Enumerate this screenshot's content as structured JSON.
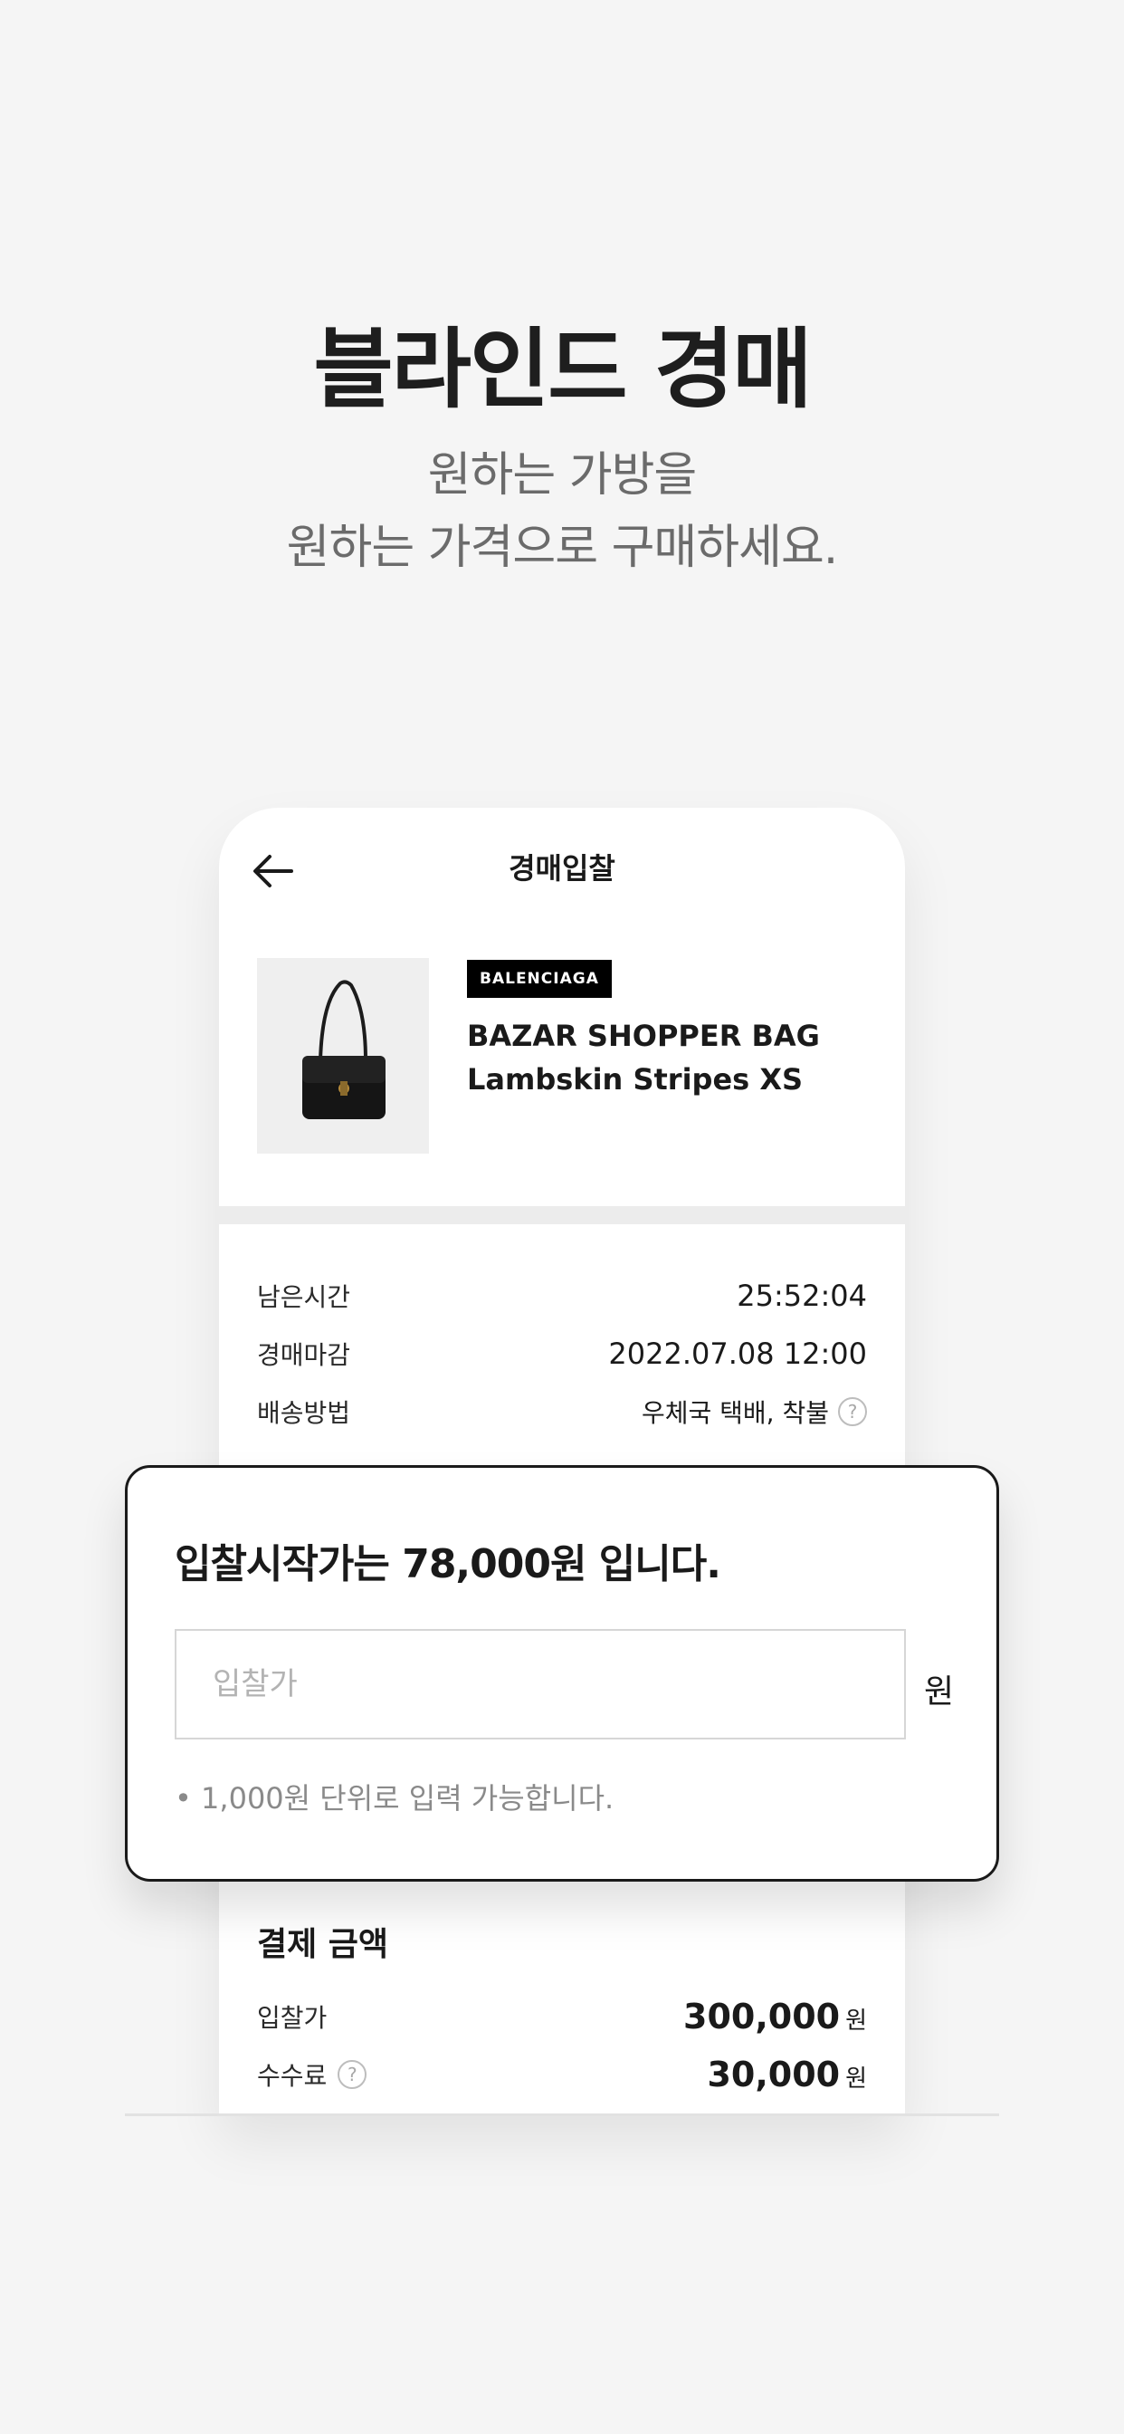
{
  "hero": {
    "title": "블라인드 경매",
    "subtitle_line1": "원하는 가방을",
    "subtitle_line2": "원하는 가격으로 구매하세요."
  },
  "app_bar": {
    "title": "경매입찰",
    "back_icon": "arrow-left-icon"
  },
  "product": {
    "brand": "BALENCIAGA",
    "name_line1": "BAZAR SHOPPER BAG",
    "name_line2": "Lambskin Stripes XS",
    "image_icon": "handbag-icon"
  },
  "auction_info": [
    {
      "label": "남은시간",
      "value": "25:52:04"
    },
    {
      "label": "경매마감",
      "value": "2022.07.08 12:00"
    },
    {
      "label": "배송방법",
      "value": "우체국 택배, 착불"
    }
  ],
  "bid_card": {
    "heading": "입찰시작가는 78,000원 입니다.",
    "input_placeholder": "입찰가",
    "input_value": "",
    "unit": "원",
    "note": "• 1,000원 단위로 입력 가능합니다."
  },
  "payment": {
    "title": "결제 금액",
    "rows": [
      {
        "label": "입찰가",
        "amount": "300,000",
        "unit": "원"
      },
      {
        "label": "수수료",
        "amount": "30,000",
        "unit": "원"
      }
    ]
  },
  "colors": {
    "background": "#f5f5f5",
    "badge": "#000000",
    "card_border": "#1a1a1a"
  }
}
